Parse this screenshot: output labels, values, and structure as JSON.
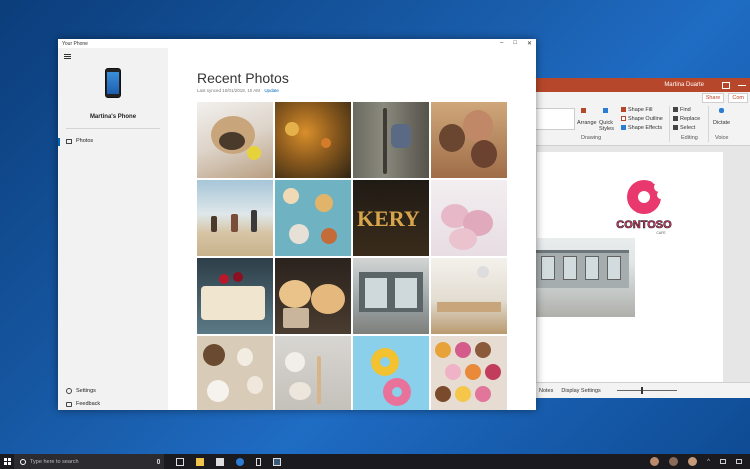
{
  "powerpoint": {
    "user_name": "Martina Duarte",
    "share_label": "Share",
    "comments_label": "Com",
    "ribbon": {
      "arrange": "Arrange",
      "quick_styles": "Quick Styles",
      "shape_fill": "Shape Fill",
      "shape_outline": "Shape Outline",
      "shape_effects": "Shape Effects",
      "find": "Find",
      "replace": "Replace",
      "select": "Select",
      "dictate": "Dictate",
      "group_drawing": "Drawing",
      "group_editing": "Editing",
      "group_voice": "Voice"
    },
    "slide": {
      "logo_text": "CONTOSO",
      "logo_sub": "CAFE"
    },
    "status": {
      "notes": "Notes",
      "display_settings": "Display Settings"
    }
  },
  "your_phone": {
    "window_title": "Your Phone",
    "phone_name": "Martina's Phone",
    "nav": {
      "photos": "Photos",
      "settings": "Settings",
      "feedback": "Feedback"
    },
    "title": "Recent Photos",
    "last_synced": "Last synced 10/01/2018, 10 AM",
    "update_link": "Update"
  },
  "taskbar": {
    "search_placeholder": "Type here to search"
  },
  "colors": {
    "accent_blue": "#0067b8",
    "ppt_red": "#b7472a",
    "logo_pink": "#e8386d"
  }
}
